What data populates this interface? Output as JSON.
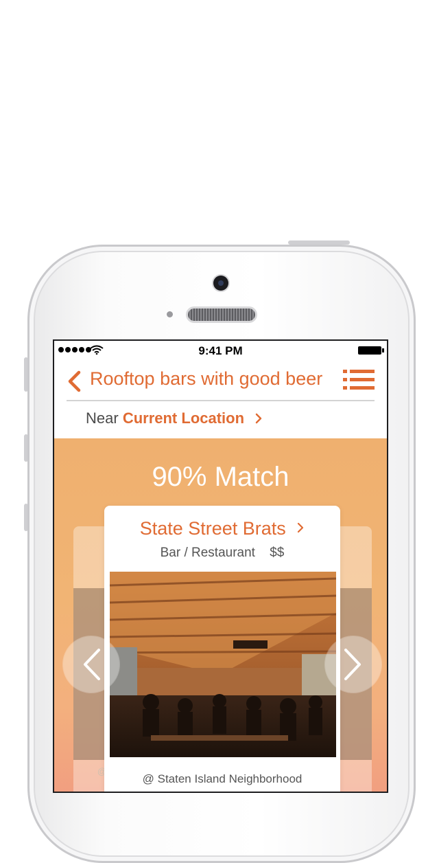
{
  "status_bar": {
    "time": "9:41 PM"
  },
  "header": {
    "title": "Rooftop bars with good beer"
  },
  "location": {
    "prefix": "Near",
    "value": "Current Location"
  },
  "match": {
    "text": "90% Match"
  },
  "card": {
    "name": "State Street Brats",
    "category": "Bar / Restaurant",
    "price": "$$",
    "neighborhood": "@ Staten Island Neighborhood"
  },
  "side_cards": {
    "left_caption": "@ Sta",
    "right_caption": "d"
  },
  "colors": {
    "accent": "#e06b33",
    "hero_top": "#efb06f",
    "hero_bottom": "#f19e80"
  },
  "icons": {
    "back": "chevron-left-icon",
    "menu": "list-icon",
    "location_chevron": "chevron-right-icon",
    "prev": "arrow-left-icon",
    "next": "arrow-right-icon"
  }
}
